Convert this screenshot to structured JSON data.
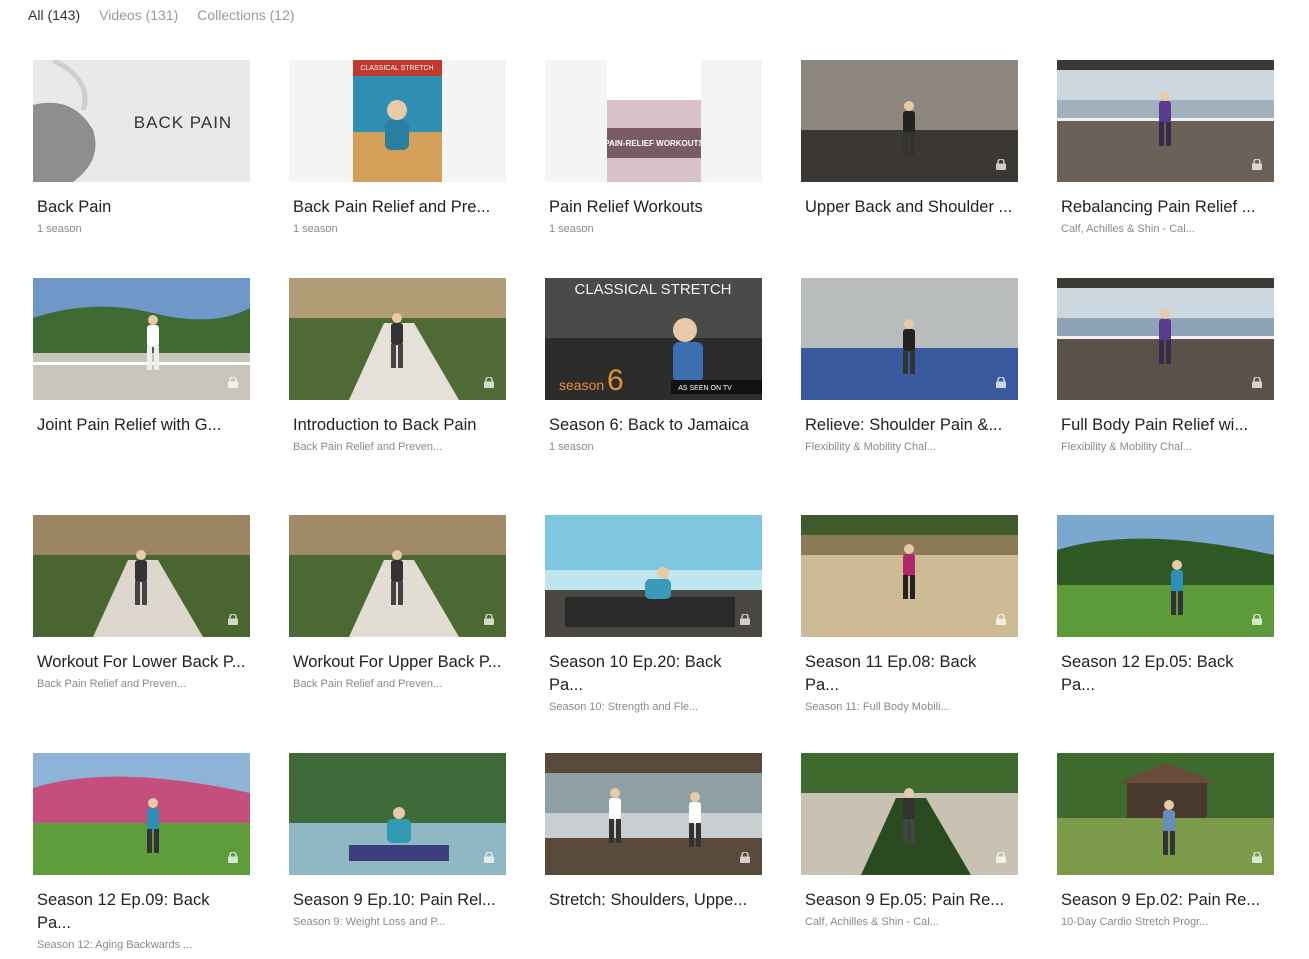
{
  "tabs": [
    {
      "label": "All (143)",
      "active": true
    },
    {
      "label": "Videos (131)",
      "active": false
    },
    {
      "label": "Collections (12)",
      "active": false
    }
  ],
  "cards": [
    {
      "title": "Back Pain",
      "subtitle": "1 season",
      "locked": false,
      "thumb": "back-pain-cover",
      "thumb_text": "BACK PAIN",
      "colors": [
        "#e9e9e9",
        "#cfcfcf",
        "#8e8e8e"
      ]
    },
    {
      "title": "Back Pain Relief and Pre...",
      "subtitle": "1 season",
      "locked": false,
      "thumb": "dvd-cover",
      "thumb_text": "CLASSICAL STRETCH",
      "colors": [
        "#f4f4f4",
        "#2f8fb2",
        "#d3a05a"
      ]
    },
    {
      "title": "Pain Relief Workouts",
      "subtitle": "1 season",
      "locked": false,
      "thumb": "book-cover",
      "thumb_text": "PAIN-RELIEF WORKOUTS",
      "colors": [
        "#f4f4f4",
        "#d8c2c8",
        "#7a5a66"
      ]
    },
    {
      "title": "Upper Back and Shoulder ...",
      "subtitle": "",
      "locked": true,
      "thumb": "studio",
      "colors": [
        "#6d6a66",
        "#8d8780",
        "#3b3733"
      ]
    },
    {
      "title": "Rebalancing Pain Relief ...",
      "subtitle": "Calf, Achilles & Shin - Cal...",
      "locked": true,
      "thumb": "terrace-sea",
      "colors": [
        "#9fb0be",
        "#6b6158",
        "#cdd7df"
      ]
    },
    {
      "title": "Joint Pain Relief with G...",
      "subtitle": "",
      "locked": true,
      "thumb": "hill-terrace",
      "colors": [
        "#6f97c7",
        "#3f6a33",
        "#c9c5bd"
      ]
    },
    {
      "title": "Introduction to Back Pain",
      "subtitle": "Back Pain Relief and Preven...",
      "locked": true,
      "thumb": "garden-path",
      "colors": [
        "#b39d76",
        "#4f6a35",
        "#e6e1d8"
      ]
    },
    {
      "title": "Season 6: Back to Jamaica",
      "subtitle": "1 season",
      "locked": false,
      "thumb": "season-cover",
      "thumb_text": "CLASSICAL STRETCH",
      "thumb_text2": "season",
      "thumb_text3": "6",
      "thumb_text4": "AS SEEN ON TV",
      "colors": [
        "#4a4a48",
        "#2c2c2a",
        "#e0913a"
      ]
    },
    {
      "title": "Relieve: Shoulder Pain &...",
      "subtitle": "Flexibility & Mobility Chal...",
      "locked": true,
      "thumb": "bright-studio",
      "colors": [
        "#d9dddf",
        "#b8bcbd",
        "#3a5aa0"
      ]
    },
    {
      "title": "Full Body Pain Relief wi...",
      "subtitle": "Flexibility & Mobility Chal...",
      "locked": true,
      "thumb": "terrace-sea",
      "colors": [
        "#8fa3b6",
        "#5a5149",
        "#cdd7df"
      ]
    },
    {
      "title": "Workout For Lower Back P...",
      "subtitle": "Back Pain Relief and Preven...",
      "locked": true,
      "thumb": "garden-path",
      "colors": [
        "#9b8563",
        "#4a6530",
        "#dcd6cc"
      ]
    },
    {
      "title": "Workout For Upper Back P...",
      "subtitle": "Back Pain Relief and Preven...",
      "locked": true,
      "thumb": "garden-path",
      "colors": [
        "#a08a68",
        "#4c6833",
        "#e2ddd3"
      ]
    },
    {
      "title": "Season 10 Ep.20: Back Pa...",
      "subtitle": "Season 10: Strength and Fle...",
      "locked": true,
      "thumb": "beach-deck",
      "colors": [
        "#7fc7de",
        "#e8dcc2",
        "#4a4642"
      ]
    },
    {
      "title": "Season 11 Ep.08: Back Pa...",
      "subtitle": "Season 11: Full Body Mobili...",
      "locked": true,
      "thumb": "sand",
      "colors": [
        "#8a7a55",
        "#cdbb95",
        "#3f5a2c"
      ]
    },
    {
      "title": "Season 12 Ep.05: Back Pa...",
      "subtitle": "",
      "locked": true,
      "thumb": "lawn-sea",
      "colors": [
        "#7aa8cf",
        "#5d9a3a",
        "#2f5a26"
      ]
    },
    {
      "title": "Season 12 Ep.09: Back Pa...",
      "subtitle": "Season 12: Aging Backwards ...",
      "locked": true,
      "thumb": "lawn-sea",
      "colors": [
        "#8db4d6",
        "#5f9c3c",
        "#c44f7c"
      ]
    },
    {
      "title": "Season 9 Ep.10: Pain Rel...",
      "subtitle": "Season 9: Weight Loss and P...",
      "locked": true,
      "thumb": "pool",
      "colors": [
        "#3f6b3a",
        "#8fb7c4",
        "#3d3f7c"
      ]
    },
    {
      "title": "Stretch: Shoulders, Uppe...",
      "subtitle": "",
      "locked": true,
      "thumb": "pavilion",
      "colors": [
        "#8fa0a5",
        "#5a4a3c",
        "#c9cfd0"
      ]
    },
    {
      "title": "Season 9 Ep.05: Pain Re...",
      "subtitle": "Calf, Achilles & Shin - Cal...",
      "locked": true,
      "thumb": "tropical-path",
      "colors": [
        "#3e6a2d",
        "#c9c2b3",
        "#2a4a1f"
      ]
    },
    {
      "title": "Season 9 Ep.02: Pain Re...",
      "subtitle": "10-Day Cardio Stretch Progr...",
      "locked": true,
      "thumb": "gazebo-lawn",
      "colors": [
        "#3f6a2e",
        "#7b9b4a",
        "#6a4a3a"
      ]
    }
  ]
}
